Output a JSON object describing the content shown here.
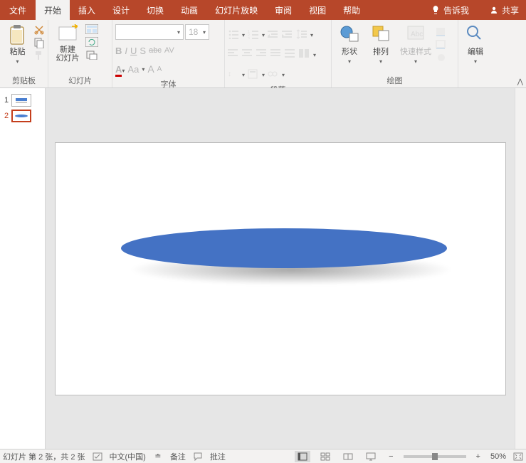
{
  "colors": {
    "accent": "#b7472a",
    "shape_fill": "#4472c4"
  },
  "titlebar": {
    "file": "文件",
    "tabs": [
      "开始",
      "插入",
      "设计",
      "切换",
      "动画",
      "幻灯片放映",
      "审阅",
      "视图",
      "帮助"
    ],
    "active_tab_index": 0,
    "tell_me": "告诉我",
    "share": "共享"
  },
  "ribbon": {
    "clipboard": {
      "label": "剪贴板",
      "paste": "粘贴"
    },
    "slides": {
      "label": "幻灯片",
      "new_slide": "新建\n幻灯片"
    },
    "font": {
      "label": "字体",
      "name": "",
      "size": "18",
      "bold": "B",
      "italic": "I",
      "underline": "U",
      "strike": "S",
      "abc": "abc",
      "av": "AV",
      "a_big": "A",
      "aa": "Aa",
      "a_inc": "A",
      "a_dec": "A"
    },
    "paragraph": {
      "label": "段落"
    },
    "drawing": {
      "label": "绘图",
      "shapes": "形状",
      "arrange": "排列",
      "quick_styles": "快速样式"
    },
    "editing": {
      "label": "",
      "edit": "编辑"
    }
  },
  "thumbnails": {
    "items": [
      {
        "num": "1"
      },
      {
        "num": "2"
      }
    ],
    "active_index": 1
  },
  "statusbar": {
    "slide_info": "幻灯片 第 2 张，共 2 张",
    "lang": "中文(中国)",
    "notes": "备注",
    "comments": "批注",
    "zoom_pct": "50%"
  }
}
